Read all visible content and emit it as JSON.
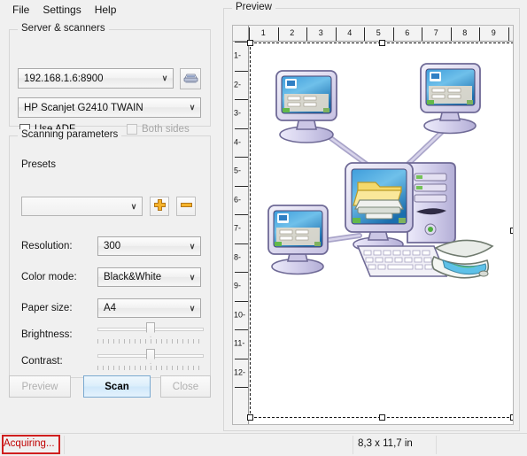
{
  "menu": {
    "items": [
      {
        "label": "File"
      },
      {
        "label": "Settings"
      },
      {
        "label": "Help"
      }
    ]
  },
  "server_group": {
    "title": "Server & scanners",
    "server_combo": {
      "value": "192.168.1.6:8900",
      "chevron": "∨"
    },
    "scanner_combo": {
      "value": "HP Scanjet G2410 TWAIN",
      "chevron": "∨"
    },
    "scanner_button": {
      "icon": "scanner-icon"
    },
    "use_adf": {
      "label": "Use ADF",
      "checked": false
    },
    "both_sides": {
      "label": "Both sides",
      "checked": false,
      "enabled": false
    }
  },
  "scanning_group": {
    "title": "Scanning parameters",
    "presets_label": "Presets",
    "presets_combo": {
      "value": "",
      "chevron": "∨"
    },
    "add_button": {
      "icon": "plus-icon"
    },
    "remove_button": {
      "icon": "minus-icon"
    },
    "rows": [
      {
        "label": "Resolution:",
        "value": "300",
        "chevron": "∨"
      },
      {
        "label": "Color mode:",
        "value": "Black&White",
        "chevron": "∨"
      },
      {
        "label": "Paper size:",
        "value": "A4",
        "chevron": "∨"
      }
    ],
    "sliders": [
      {
        "label": "Brightness:",
        "percent": 50
      },
      {
        "label": "Contrast:",
        "percent": 50
      }
    ]
  },
  "buttons": {
    "preview": {
      "label": "Preview",
      "enabled": false
    },
    "scan": {
      "label": "Scan",
      "primary": true
    },
    "close": {
      "label": "Close",
      "enabled": false
    }
  },
  "preview": {
    "title": "Preview",
    "ruler_h_labels": [
      "1",
      "2",
      "3",
      "4",
      "5",
      "6",
      "7",
      "8",
      "9"
    ],
    "ruler_v_labels": [
      "1",
      "2",
      "3",
      "4",
      "5",
      "6",
      "7",
      "8",
      "9",
      "10",
      "11",
      "12"
    ],
    "artwork_description": "network-scanning-illustration"
  },
  "statusbar": {
    "message": "Acquiring...",
    "message_color": "#c00000",
    "highlight_color": "#d01f1f",
    "dimensions": "8,3 x 11,7 in"
  },
  "colors": {
    "window_bg": "#f0f0f0",
    "accent_primary": "#cfe7fa",
    "preset_add": "#f0a81e",
    "preset_remove": "#e0951a"
  }
}
